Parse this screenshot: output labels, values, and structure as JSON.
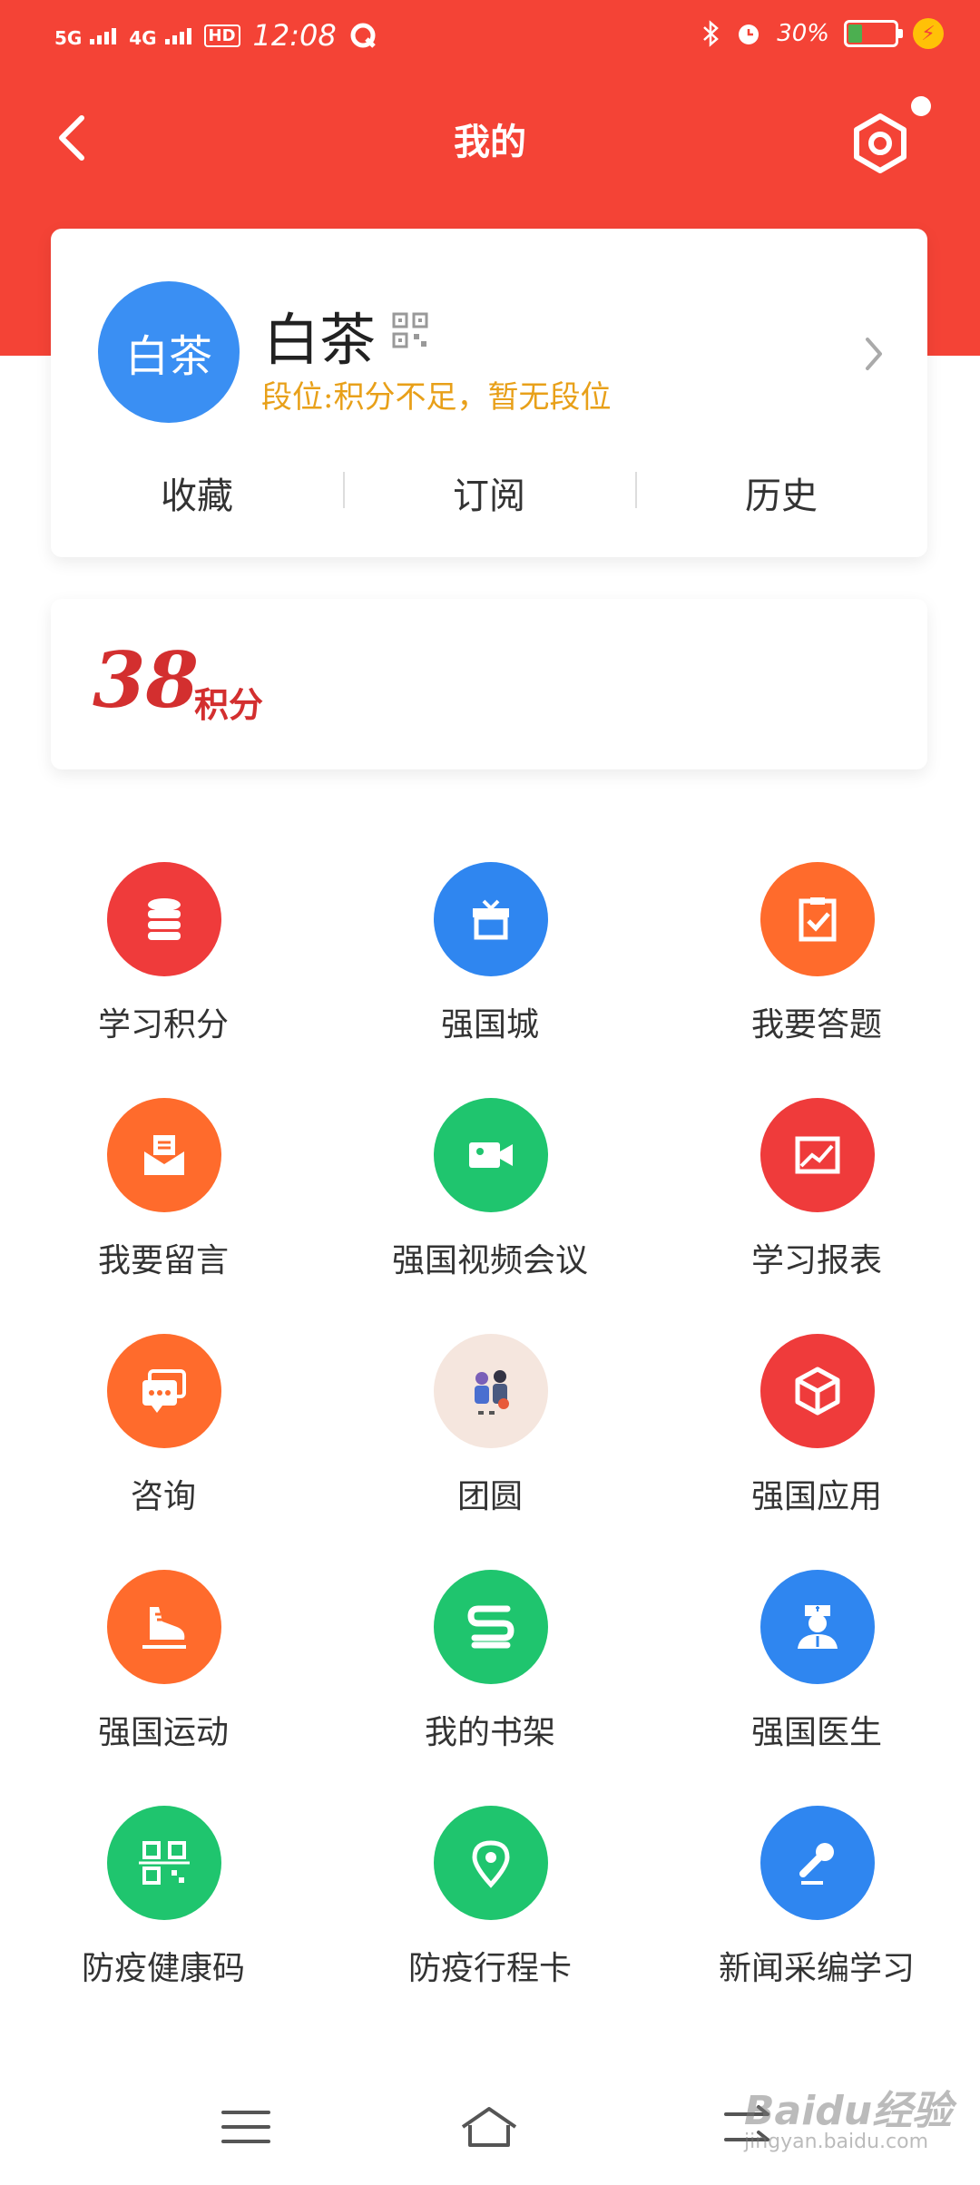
{
  "status": {
    "signal1": "5G",
    "signal2": "4G",
    "hd": "HD",
    "time": "12:08",
    "battery_percent": "30%",
    "battery_level": 0.3,
    "battery_color": "#4caf50"
  },
  "header": {
    "title": "我的",
    "accent_color": "#f44336"
  },
  "profile": {
    "avatar_text": "白茶",
    "name": "白茶",
    "rank": "段位:积分不足，暂无段位",
    "quick_links": [
      "收藏",
      "订阅",
      "历史"
    ]
  },
  "points": {
    "value": "38",
    "unit": "积分"
  },
  "grid": [
    {
      "label": "学习积分",
      "icon": "database-icon",
      "color": "#ef3b3b"
    },
    {
      "label": "强国城",
      "icon": "gift-icon",
      "color": "#2f86f0"
    },
    {
      "label": "我要答题",
      "icon": "clipboard-check-icon",
      "color": "#ff6b2c"
    },
    {
      "label": "我要留言",
      "icon": "message-envelope-icon",
      "color": "#ff6b2c"
    },
    {
      "label": "强国视频会议",
      "icon": "video-camera-icon",
      "color": "#1fc56e"
    },
    {
      "label": "学习报表",
      "icon": "chart-image-icon",
      "color": "#ef3b3b"
    },
    {
      "label": "咨询",
      "icon": "chat-bubbles-icon",
      "color": "#ff6b2c"
    },
    {
      "label": "团圆",
      "icon": "reunion-illustration-icon",
      "color": "#f5e6de"
    },
    {
      "label": "强国应用",
      "icon": "cube-icon",
      "color": "#ef3b3b"
    },
    {
      "label": "强国运动",
      "icon": "sneaker-icon",
      "color": "#ff6b2c"
    },
    {
      "label": "我的书架",
      "icon": "bookshelf-icon",
      "color": "#1fc56e"
    },
    {
      "label": "强国医生",
      "icon": "doctor-icon",
      "color": "#2f86f0"
    },
    {
      "label": "防疫健康码",
      "icon": "qr-scan-icon",
      "color": "#1fc56e"
    },
    {
      "label": "防疫行程卡",
      "icon": "location-pin-icon",
      "color": "#1fc56e"
    },
    {
      "label": "新闻采编学习",
      "icon": "microphone-icon",
      "color": "#2f86f0"
    }
  ],
  "watermark": {
    "brand": "Baidu经验",
    "url": "jingyan.baidu.com"
  }
}
